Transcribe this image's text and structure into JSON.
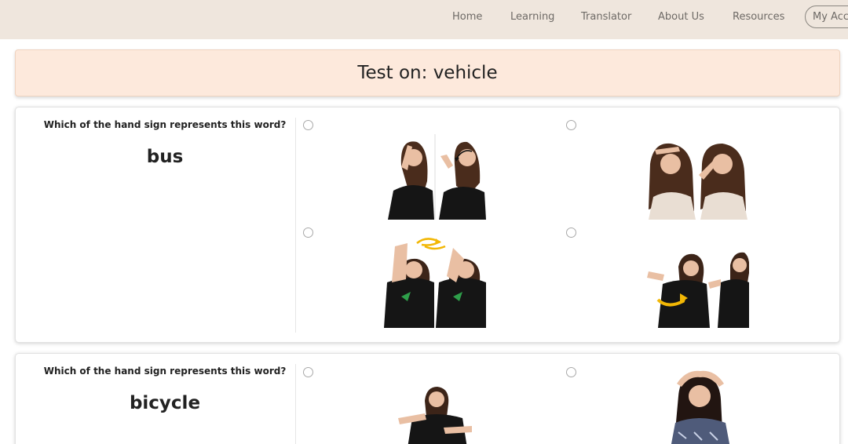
{
  "nav": {
    "links": [
      "Home",
      "Learning",
      "Translator",
      "About Us",
      "Resources"
    ],
    "account_label": "My Account"
  },
  "header": {
    "title": "Test on: vehicle"
  },
  "questions": [
    {
      "prompt": "Which of the hand sign represents this word?",
      "word": "bus",
      "options": [
        "sign-option-a-icon",
        "sign-option-b-icon",
        "sign-option-c-icon",
        "sign-option-d-icon"
      ]
    },
    {
      "prompt": "Which of the hand sign represents this word?",
      "word": "bicycle",
      "options": [
        "sign-option-a-icon",
        "sign-option-b-icon"
      ]
    }
  ],
  "colors": {
    "navbar": "#efe6dd",
    "banner": "#fde9dc",
    "arrow": "#f2b705",
    "shirt": "#111111",
    "hair": "#3c2418",
    "skin": "#e9bfa3"
  }
}
